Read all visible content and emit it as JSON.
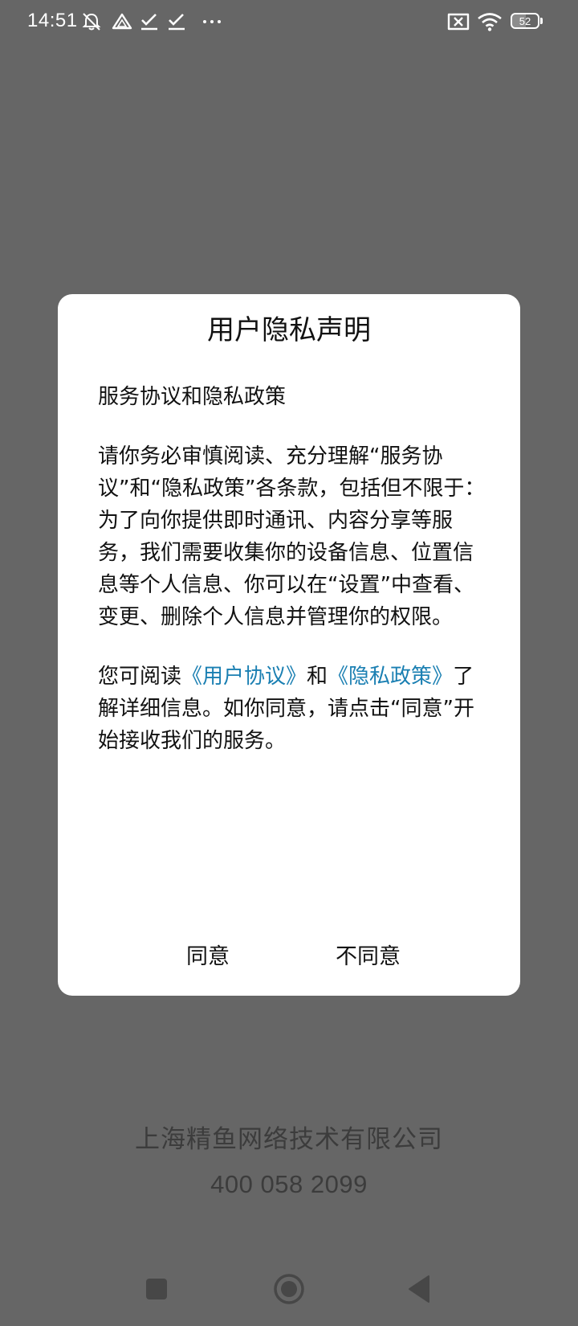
{
  "status_bar": {
    "time": "14:51",
    "battery_level": "52",
    "battery_percent": 52,
    "icons": [
      "notifications-muted-icon",
      "drive-icon",
      "download-done-icon",
      "download-done-icon",
      "more-dots-icon",
      "sim-missing-icon",
      "wifi-icon",
      "battery-icon"
    ]
  },
  "dialog": {
    "title": "用户隐私声明",
    "subtitle": "服务协议和隐私政策",
    "paragraph1": "请你务必审慎阅读、充分理解“服务协议”和“隐私政策”各条款，包括但不限于：为了向你提供即时通讯、内容分享等服务，我们需要收集你的设备信息、位置信息等个人信息、你可以在“设置”中查看、变更、删除个人信息并管理你的权限。",
    "paragraph2_prefix": "您可阅读",
    "user_agreement_link": "《用户协议》",
    "paragraph2_and": "和",
    "privacy_policy_link": "《隐私政策》",
    "paragraph2_suffix": "了解详细信息。如你同意，请点击“同意”开始接收我们的服务。",
    "agree_label": "同意",
    "disagree_label": "不同意",
    "link_color": "#1a7fb2"
  },
  "footer": {
    "company_name": "上海精鱼网络技术有限公司",
    "phone": "400 058 2099"
  },
  "nav_bar": {
    "icons": [
      "recents-square-icon",
      "home-circle-icon",
      "back-triangle-icon"
    ]
  },
  "colors": {
    "overlay_background": "#666666",
    "dialog_background": "#ffffff",
    "footer_text": "#3c3c3c"
  }
}
